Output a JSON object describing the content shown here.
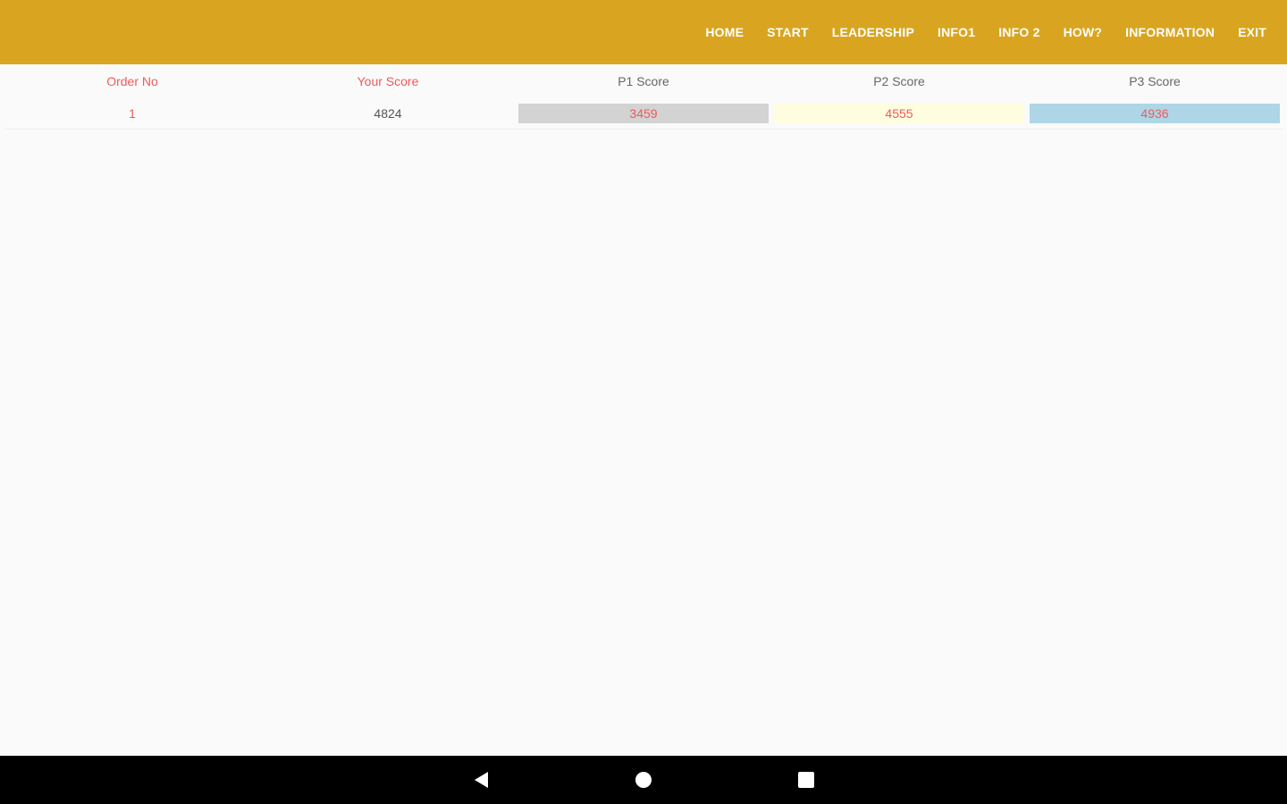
{
  "menu": {
    "items": [
      "HOME",
      "START",
      "LEADERSHIP",
      "INFO1",
      "INFO 2",
      "HOW?",
      "INFORMATION",
      "EXIT"
    ]
  },
  "table": {
    "headers": [
      "Order No",
      "Your Score",
      "P1 Score",
      "P2 Score",
      "P3 Score"
    ],
    "rows": [
      {
        "order_no": "1",
        "your_score": "4824",
        "p1_score": "3459",
        "p2_score": "4555",
        "p3_score": "4936"
      }
    ]
  },
  "colors": {
    "appbar": "#d9a520",
    "p1_bg": "#d3d3d3",
    "p2_bg": "#fefde0",
    "p3_bg": "#aed6e6",
    "accent_red": "#f05a5a"
  },
  "navbar": {
    "icons": [
      "back-icon",
      "home-icon",
      "recents-icon"
    ]
  }
}
